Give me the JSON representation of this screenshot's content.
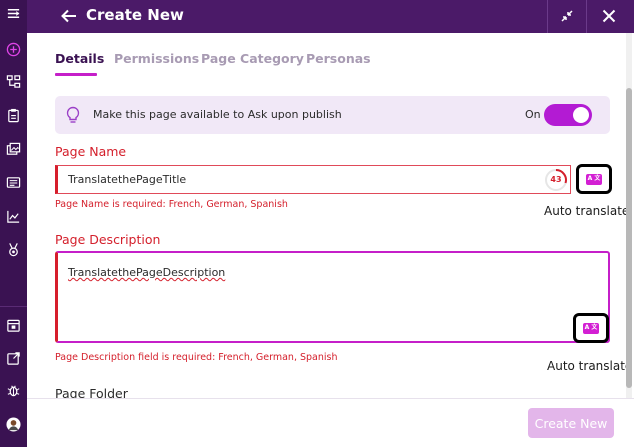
{
  "header": {
    "title": "Create New"
  },
  "tabs": [
    {
      "label": "Details",
      "active": true
    },
    {
      "label": "Permissions",
      "active": false
    },
    {
      "label": "Page Category",
      "active": false
    },
    {
      "label": "Personas",
      "active": false
    }
  ],
  "ask_banner": {
    "text": "Make this page available to Ask upon publish",
    "toggle_label": "On",
    "toggle_on": true
  },
  "page_name": {
    "label": "Page Name",
    "value": "TranslatethePageTitle",
    "char_counter": "43",
    "error": "Page Name is required: French, German, Spanish",
    "auto_translate_label": "Auto translate"
  },
  "page_description": {
    "label": "Page Description",
    "value": "TranslatethePageDescription",
    "error": "Page Description field is required: French, German, Spanish",
    "auto_translate_label": "Auto translate"
  },
  "page_folder": {
    "label": "Page Folder"
  },
  "footer": {
    "create_button_label": "Create New"
  },
  "colors": {
    "rail": "#3a1252",
    "header": "#4b1a68",
    "accent": "#c51fc9",
    "error": "#d41f2b",
    "disabled_button": "#e3b6ea"
  },
  "rail_icons": [
    "menu-icon",
    "add-circle-icon",
    "sitemap-icon",
    "clipboard-icon",
    "images-icon",
    "newspaper-icon",
    "analytics-icon",
    "award-icon",
    "calendar-icon",
    "external-link-icon",
    "bug-icon",
    "user-avatar"
  ]
}
